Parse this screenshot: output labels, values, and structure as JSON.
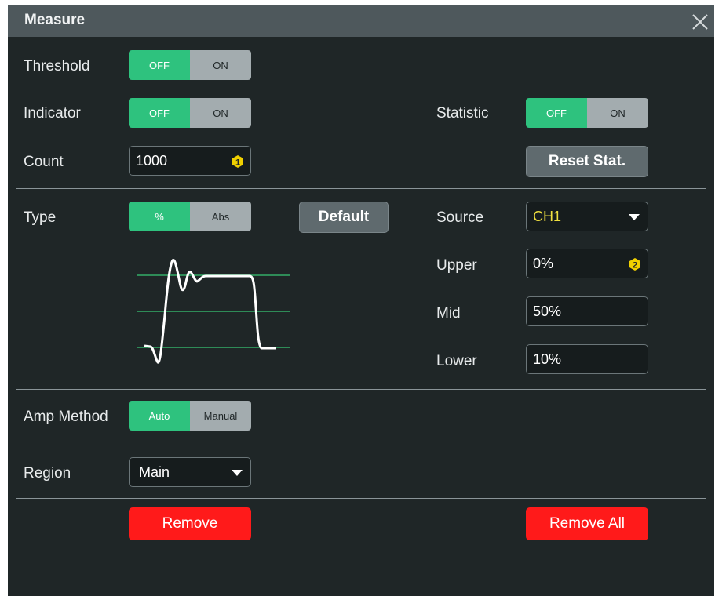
{
  "dialog": {
    "title": "Measure",
    "close_icon": "close-icon"
  },
  "threshold": {
    "label": "Threshold",
    "off": "OFF",
    "on": "ON",
    "selected": "OFF"
  },
  "indicator": {
    "label": "Indicator",
    "off": "OFF",
    "on": "ON",
    "selected": "OFF"
  },
  "statistic": {
    "label": "Statistic",
    "off": "OFF",
    "on": "ON",
    "selected": "OFF"
  },
  "count": {
    "label": "Count",
    "value": "1000",
    "badge": "1"
  },
  "reset_stat": {
    "label": "Reset Stat."
  },
  "type": {
    "label": "Type",
    "opt1": "%",
    "opt2": "Abs",
    "selected": "%"
  },
  "default_button": {
    "label": "Default"
  },
  "source": {
    "label": "Source",
    "value": "CH1"
  },
  "upper": {
    "label": "Upper",
    "value": "0%",
    "badge": "2"
  },
  "mid": {
    "label": "Mid",
    "value": "50%"
  },
  "lower": {
    "label": "Lower",
    "value": "10%"
  },
  "amp_method": {
    "label": "Amp Method",
    "opt1": "Auto",
    "opt2": "Manual",
    "selected": "Auto"
  },
  "region": {
    "label": "Region",
    "value": "Main"
  },
  "remove": {
    "label": "Remove"
  },
  "remove_all": {
    "label": "Remove All"
  },
  "colors": {
    "background": "#1f2627",
    "titlebar": "#4e585c",
    "toggle_active": "#2ec27e",
    "toggle_inactive": "#a3acaf",
    "source_text": "#f0e040",
    "badge": "#f0d000",
    "remove_button": "#ff1a1a",
    "threshold_line": "#2e8b57"
  }
}
